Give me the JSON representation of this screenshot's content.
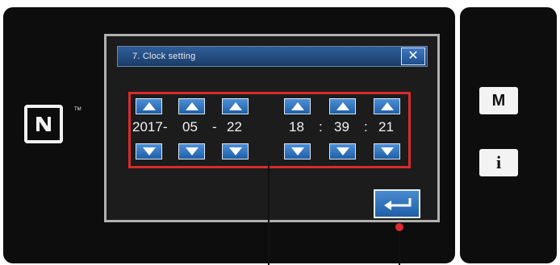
{
  "dialog": {
    "title": "7. Clock setting",
    "close_label": "✕"
  },
  "clock": {
    "year": "2017-",
    "month": "05",
    "sep1": "-",
    "day": "22",
    "hour": "18",
    "sep2": ":",
    "minute": "39",
    "sep3": ":",
    "second": "21"
  },
  "side": {
    "mode_label": "M",
    "info_label": "i"
  },
  "icons": [
    "nfc-icon",
    "up-arrow-icon",
    "down-arrow-icon",
    "enter-icon",
    "close-icon"
  ]
}
